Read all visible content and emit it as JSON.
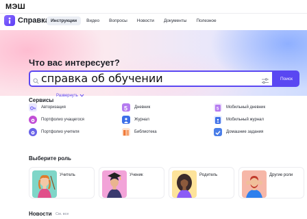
{
  "brand": "МЭШ",
  "app": {
    "title": "Справка"
  },
  "nav": {
    "items": [
      "Инструкции",
      "Видео",
      "Вопросы",
      "Новости",
      "Документы",
      "Полезное"
    ],
    "active_index": 0
  },
  "hero": {
    "title": "Что вас интересует?",
    "search": {
      "value": "справка об обучении",
      "button_label": "Поиск"
    }
  },
  "services": {
    "title": "Сервисы",
    "expand_label": "Развернуть",
    "items": [
      {
        "label": "Авторизация",
        "icon": "key-icon",
        "color": "#7b6cf6"
      },
      {
        "label": "Дневник",
        "icon": "diary-5-icon",
        "color": "#b57bf0"
      },
      {
        "label": "Мобильный дневник",
        "icon": "mobile-diary-icon",
        "color": "#b57bf0"
      },
      {
        "label": "Портфолио учащегося",
        "icon": "student-portfolio-icon",
        "color": "#c24fd6"
      },
      {
        "label": "Журнал",
        "icon": "journal-icon",
        "color": "#3d6fe8"
      },
      {
        "label": "Мобильный журнал",
        "icon": "mobile-journal-icon",
        "color": "#3d6fe8"
      },
      {
        "label": "Портфолио учителя",
        "icon": "teacher-portfolio-icon",
        "color": "#6a63e8"
      },
      {
        "label": "Библиотека",
        "icon": "library-icon",
        "color": "#f07a3a"
      },
      {
        "label": "Домашние задания",
        "icon": "homework-icon",
        "color": "#4a7ee8"
      }
    ]
  },
  "roles": {
    "title": "Выберите роль",
    "items": [
      {
        "label": "Учитель",
        "bg": "#7fd6c8"
      },
      {
        "label": "Ученик",
        "bg": "#f2a3d8"
      },
      {
        "label": "Родитель",
        "bg": "#fde39a"
      },
      {
        "label": "Другие роли",
        "bg": "#f6b7a8"
      }
    ]
  },
  "news": {
    "title": "Новости",
    "see_all": "См. все"
  },
  "colors": {
    "accent": "#5a47f2"
  }
}
